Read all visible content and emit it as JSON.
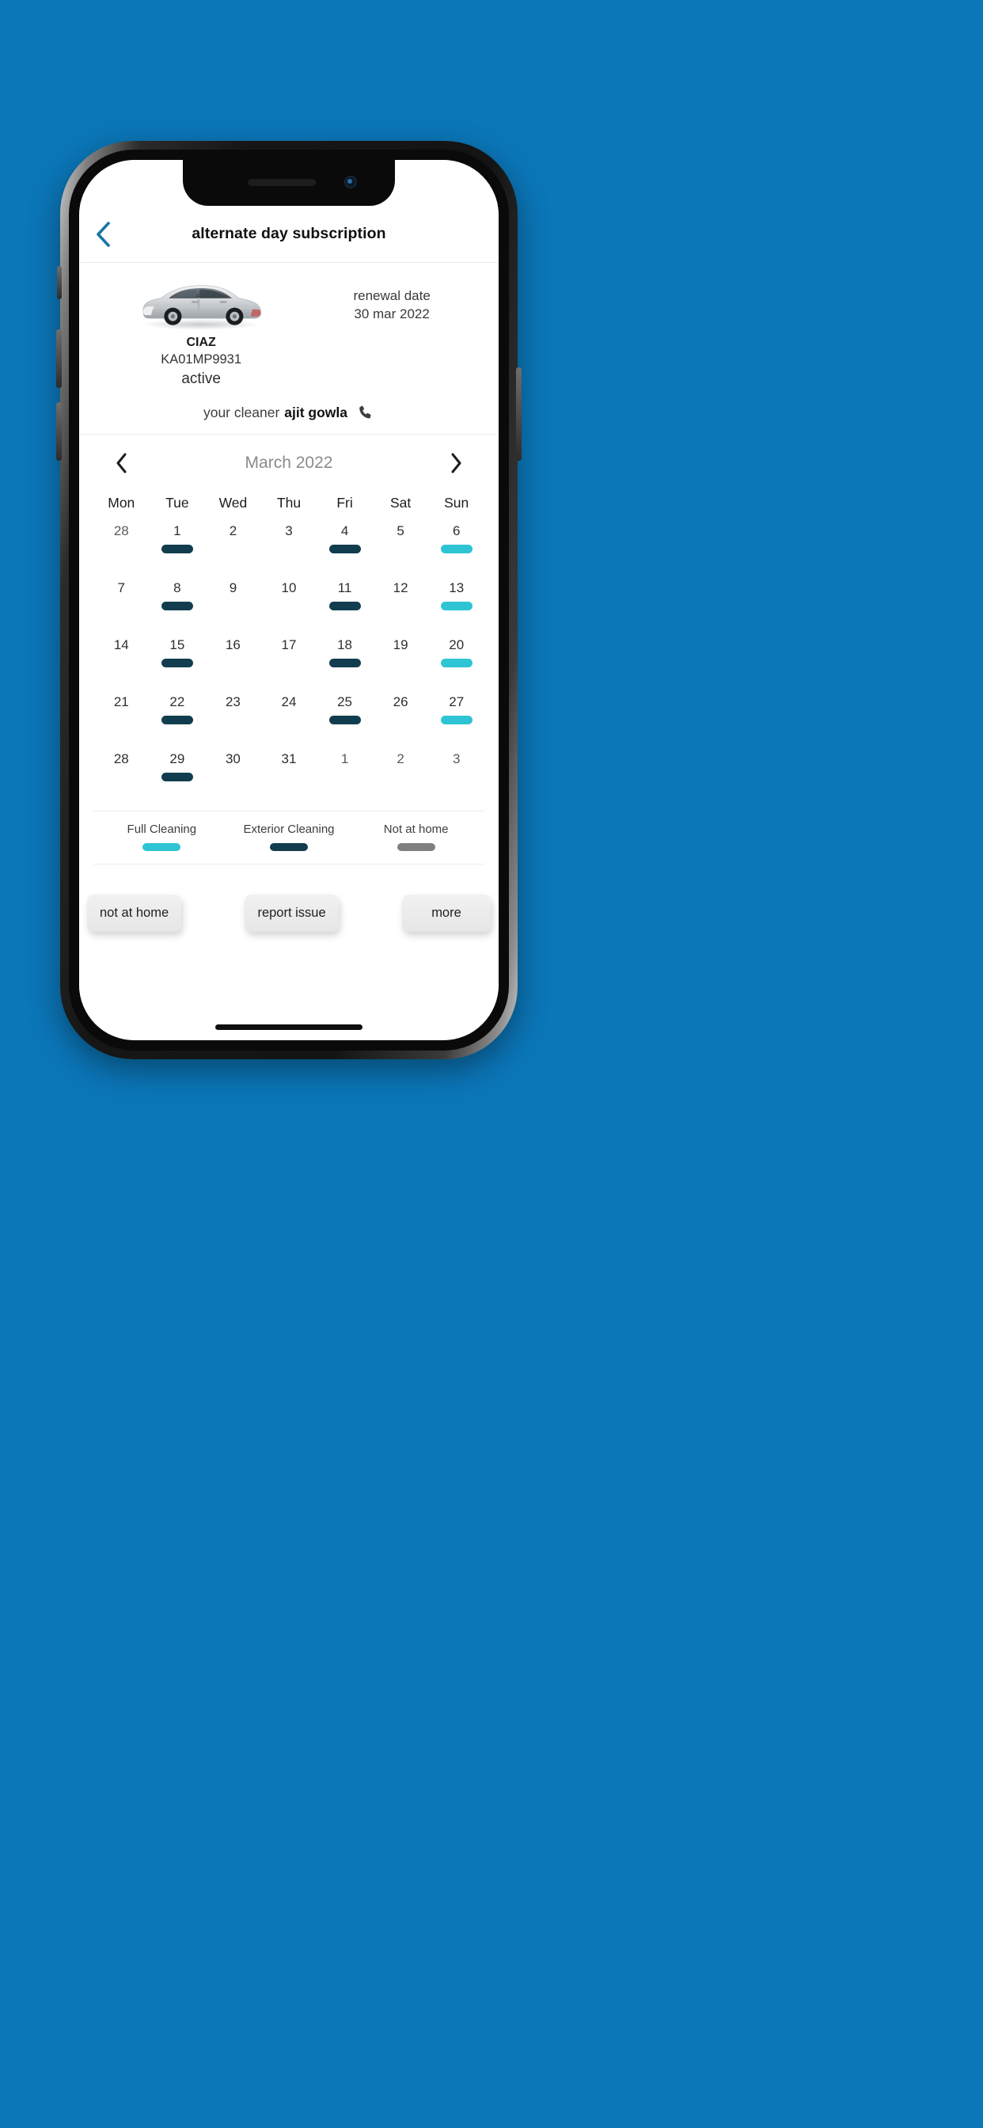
{
  "appbar": {
    "title": "alternate day subscription",
    "back_icon": "chevron-left-icon",
    "back_color": "#1b73a8"
  },
  "vehicle": {
    "image_alt": "silver-sedan-car",
    "name": "CIAZ",
    "plate": "KA01MP9931",
    "status": "active",
    "renewal_label": "renewal date",
    "renewal_value": "30 mar 2022"
  },
  "cleaner": {
    "label": "your cleaner",
    "name": "ajit gowla",
    "call_icon": "phone-icon"
  },
  "calendar": {
    "month": "March 2022",
    "prev_icon": "chevron-left-icon",
    "next_icon": "chevron-right-icon",
    "weekdays": [
      "Mon",
      "Tue",
      "Wed",
      "Thu",
      "Fri",
      "Sat",
      "Sun"
    ],
    "weeks": [
      [
        {
          "day": "28",
          "mark": "none",
          "muted": true
        },
        {
          "day": "1",
          "mark": "exterior",
          "muted": false
        },
        {
          "day": "2",
          "mark": "none",
          "muted": false
        },
        {
          "day": "3",
          "mark": "none",
          "muted": false
        },
        {
          "day": "4",
          "mark": "exterior",
          "muted": false
        },
        {
          "day": "5",
          "mark": "none",
          "muted": false
        },
        {
          "day": "6",
          "mark": "full",
          "muted": false
        }
      ],
      [
        {
          "day": "7",
          "mark": "none",
          "muted": false
        },
        {
          "day": "8",
          "mark": "exterior",
          "muted": false
        },
        {
          "day": "9",
          "mark": "none",
          "muted": false
        },
        {
          "day": "10",
          "mark": "none",
          "muted": false
        },
        {
          "day": "11",
          "mark": "exterior",
          "muted": false
        },
        {
          "day": "12",
          "mark": "none",
          "muted": false
        },
        {
          "day": "13",
          "mark": "full",
          "muted": false
        }
      ],
      [
        {
          "day": "14",
          "mark": "none",
          "muted": false
        },
        {
          "day": "15",
          "mark": "exterior",
          "muted": false
        },
        {
          "day": "16",
          "mark": "none",
          "muted": false
        },
        {
          "day": "17",
          "mark": "none",
          "muted": false
        },
        {
          "day": "18",
          "mark": "exterior",
          "muted": false
        },
        {
          "day": "19",
          "mark": "none",
          "muted": false
        },
        {
          "day": "20",
          "mark": "full",
          "muted": false
        }
      ],
      [
        {
          "day": "21",
          "mark": "none",
          "muted": false
        },
        {
          "day": "22",
          "mark": "exterior",
          "muted": false
        },
        {
          "day": "23",
          "mark": "none",
          "muted": false
        },
        {
          "day": "24",
          "mark": "none",
          "muted": false
        },
        {
          "day": "25",
          "mark": "exterior",
          "muted": false
        },
        {
          "day": "26",
          "mark": "none",
          "muted": false
        },
        {
          "day": "27",
          "mark": "full",
          "muted": false
        }
      ],
      [
        {
          "day": "28",
          "mark": "none",
          "muted": false
        },
        {
          "day": "29",
          "mark": "exterior",
          "muted": false
        },
        {
          "day": "30",
          "mark": "none",
          "muted": false
        },
        {
          "day": "31",
          "mark": "none",
          "muted": false
        },
        {
          "day": "1",
          "mark": "none",
          "muted": true
        },
        {
          "day": "2",
          "mark": "none",
          "muted": true
        },
        {
          "day": "3",
          "mark": "none",
          "muted": true
        }
      ]
    ]
  },
  "legend": [
    {
      "label": "Full Cleaning",
      "mark": "full",
      "color": "#2ec4d4"
    },
    {
      "label": "Exterior Cleaning",
      "mark": "exterior",
      "color": "#123d4f"
    },
    {
      "label": "Not at home",
      "mark": "away",
      "color": "#808080"
    }
  ],
  "actions": [
    {
      "label": "not at home"
    },
    {
      "label": "report issue"
    },
    {
      "label": "more"
    }
  ],
  "theme": {
    "background": "#0b76b8",
    "accent_cyan": "#2ec4d4",
    "accent_dark": "#123d4f",
    "accent_gray": "#808080",
    "link_blue": "#1b73a8"
  }
}
